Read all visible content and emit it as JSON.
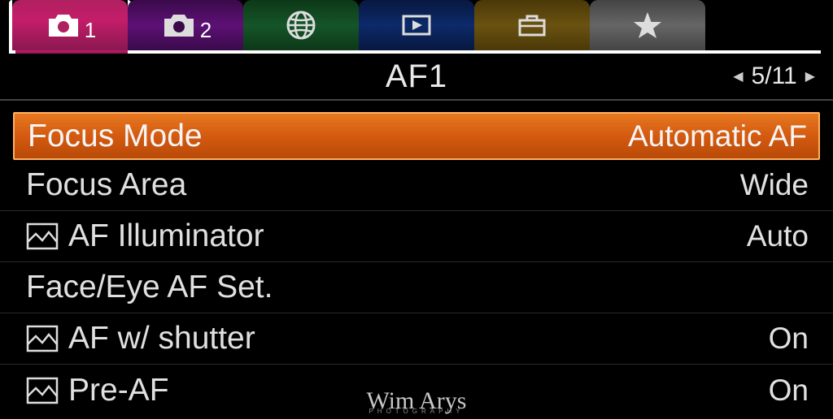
{
  "tabs": {
    "camera1_sub": "1",
    "camera2_sub": "2"
  },
  "header": {
    "title": "AF1",
    "page_current": "5",
    "page_total": "11",
    "page_display": "5/11"
  },
  "menu": {
    "items": [
      {
        "label": "Focus Mode",
        "value": "Automatic AF",
        "has_icon": false,
        "selected": true
      },
      {
        "label": "Focus Area",
        "value": "Wide",
        "has_icon": false,
        "selected": false
      },
      {
        "label": "AF Illuminator",
        "value": "Auto",
        "has_icon": true,
        "selected": false
      },
      {
        "label": "Face/Eye AF Set.",
        "value": "",
        "has_icon": false,
        "selected": false
      },
      {
        "label": "AF w/ shutter",
        "value": "On",
        "has_icon": true,
        "selected": false
      },
      {
        "label": "Pre-AF",
        "value": "On",
        "has_icon": true,
        "selected": false
      }
    ]
  },
  "watermark": {
    "main": "Wim Arys",
    "sub": "PHOTOGRAPHY"
  }
}
